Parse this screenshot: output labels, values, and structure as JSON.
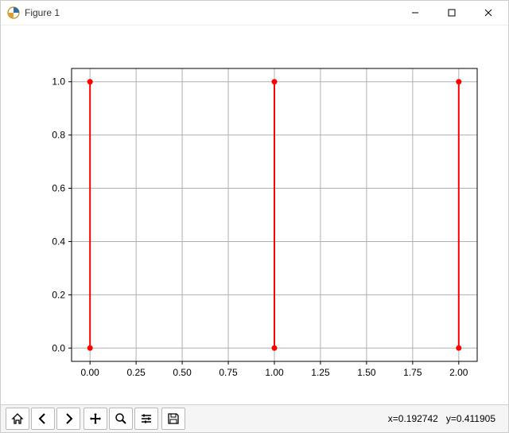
{
  "window": {
    "title": "Figure 1"
  },
  "toolbar": {
    "coord_readout": "x=0.192742   y=0.411905"
  },
  "chart_data": {
    "type": "stem",
    "x": [
      0,
      1,
      2
    ],
    "y": [
      1,
      1,
      1
    ],
    "baseline": 0,
    "color": "#ff0000",
    "xlim": [
      -0.1,
      2.1
    ],
    "ylim": [
      -0.05,
      1.05
    ],
    "xticks": [
      0.0,
      0.25,
      0.5,
      0.75,
      1.0,
      1.25,
      1.5,
      1.75,
      2.0
    ],
    "yticks": [
      0.0,
      0.2,
      0.4,
      0.6,
      0.8,
      1.0
    ],
    "xtick_labels": [
      "0.00",
      "0.25",
      "0.50",
      "0.75",
      "1.00",
      "1.25",
      "1.50",
      "1.75",
      "2.00"
    ],
    "ytick_labels": [
      "0.0",
      "0.2",
      "0.4",
      "0.6",
      "0.8",
      "1.0"
    ],
    "grid": true,
    "title": "",
    "xlabel": "",
    "ylabel": ""
  }
}
